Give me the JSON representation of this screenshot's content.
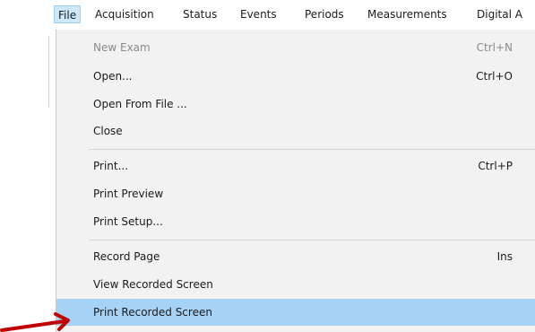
{
  "menubar": {
    "items": [
      {
        "label": "File"
      },
      {
        "label": "Acquisition"
      },
      {
        "label": "Status"
      },
      {
        "label": "Events"
      },
      {
        "label": "Periods"
      },
      {
        "label": "Measurements"
      },
      {
        "label": "Digital A"
      }
    ]
  },
  "file_menu": {
    "groups": [
      [
        {
          "label": "New Exam",
          "shortcut": "Ctrl+N",
          "enabled": false
        },
        {
          "label": "Open...",
          "shortcut": "Ctrl+O",
          "enabled": true
        },
        {
          "label": "Open From File ...",
          "shortcut": "",
          "enabled": true
        },
        {
          "label": "Close",
          "shortcut": "",
          "enabled": true
        }
      ],
      [
        {
          "label": "Print...",
          "shortcut": "Ctrl+P",
          "enabled": true
        },
        {
          "label": "Print Preview",
          "shortcut": "",
          "enabled": true
        },
        {
          "label": "Print Setup...",
          "shortcut": "",
          "enabled": true
        }
      ],
      [
        {
          "label": "Record Page",
          "shortcut": "Ins",
          "enabled": true
        },
        {
          "label": "View Recorded Screen",
          "shortcut": "",
          "enabled": true
        },
        {
          "label": "Print Recorded Screen",
          "shortcut": "",
          "enabled": true,
          "highlighted": true
        }
      ]
    ]
  },
  "colors": {
    "menu_bg": "#f2f2f2",
    "highlight": "#a6d2f5",
    "active_menu": "#cce8ff",
    "arrow": "#c00000",
    "disabled_text": "#8a8a8a"
  },
  "annotation": {
    "icon": "red-arrow-icon"
  }
}
